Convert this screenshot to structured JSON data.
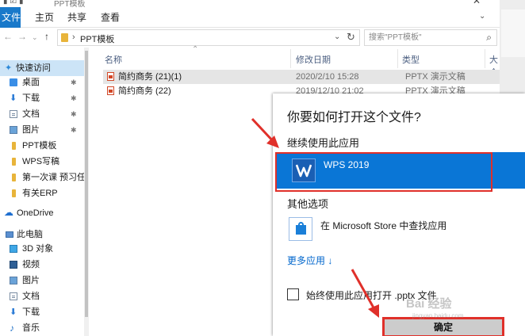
{
  "titlebar": {
    "title": "PPT模板"
  },
  "ribbon": {
    "tabs": [
      {
        "label": "文件"
      },
      {
        "label": "主页"
      },
      {
        "label": "共享"
      },
      {
        "label": "查看"
      }
    ]
  },
  "nav": {
    "path_segment": "PPT模板",
    "search_placeholder": "搜索\"PPT模板\""
  },
  "sidebar": {
    "items": [
      {
        "label": "快速访问",
        "icon": "star-icon"
      },
      {
        "label": "桌面",
        "icon": "desktop-icon",
        "pinned": true
      },
      {
        "label": "下载",
        "icon": "download-icon",
        "pinned": true
      },
      {
        "label": "文档",
        "icon": "documents-icon",
        "pinned": true
      },
      {
        "label": "图片",
        "icon": "pictures-icon",
        "pinned": true
      },
      {
        "label": "PPT模板",
        "icon": "folder-icon"
      },
      {
        "label": "WPS写稿",
        "icon": "folder-icon"
      },
      {
        "label": "第一次课 预习任",
        "icon": "folder-icon"
      },
      {
        "label": "有关ERP",
        "icon": "folder-icon"
      },
      {
        "label": "OneDrive",
        "icon": "cloud-icon"
      },
      {
        "label": "此电脑",
        "icon": "computer-icon"
      },
      {
        "label": "3D 对象",
        "icon": "cube-icon"
      },
      {
        "label": "视频",
        "icon": "video-icon"
      },
      {
        "label": "图片",
        "icon": "pictures-icon"
      },
      {
        "label": "文档",
        "icon": "documents-icon"
      },
      {
        "label": "下载",
        "icon": "download-icon"
      },
      {
        "label": "音乐",
        "icon": "music-icon"
      }
    ]
  },
  "filelist": {
    "columns": [
      {
        "label": "名称"
      },
      {
        "label": "修改日期"
      },
      {
        "label": "类型"
      },
      {
        "label": "大个"
      }
    ],
    "rows": [
      {
        "name": "简约商务 (21)(1)",
        "date": "2020/2/10 15:28",
        "type": "PPTX 演示文稿",
        "selected": true
      },
      {
        "name": "简约商务 (22)",
        "date": "2019/12/10 21:02",
        "type": "PPTX 演示文稿",
        "selected": false
      }
    ]
  },
  "dialog": {
    "title": "你要如何打开这个文件?",
    "keep_using_label": "继续使用此应用",
    "wps_name": "WPS 2019",
    "other_options_label": "其他选项",
    "store_label": "在 Microsoft Store 中查找应用",
    "more_apps_label": "更多应用 ↓",
    "always_use_label": "始终使用此应用打开 .pptx 文件",
    "ok_label": "确定"
  },
  "watermark": {
    "text": "Bai 经验",
    "sub": "jingyan.baidu.com"
  },
  "colors": {
    "accent": "#0a76d6",
    "highlight_red": "#e0302a",
    "file_tab": "#1979ca"
  }
}
